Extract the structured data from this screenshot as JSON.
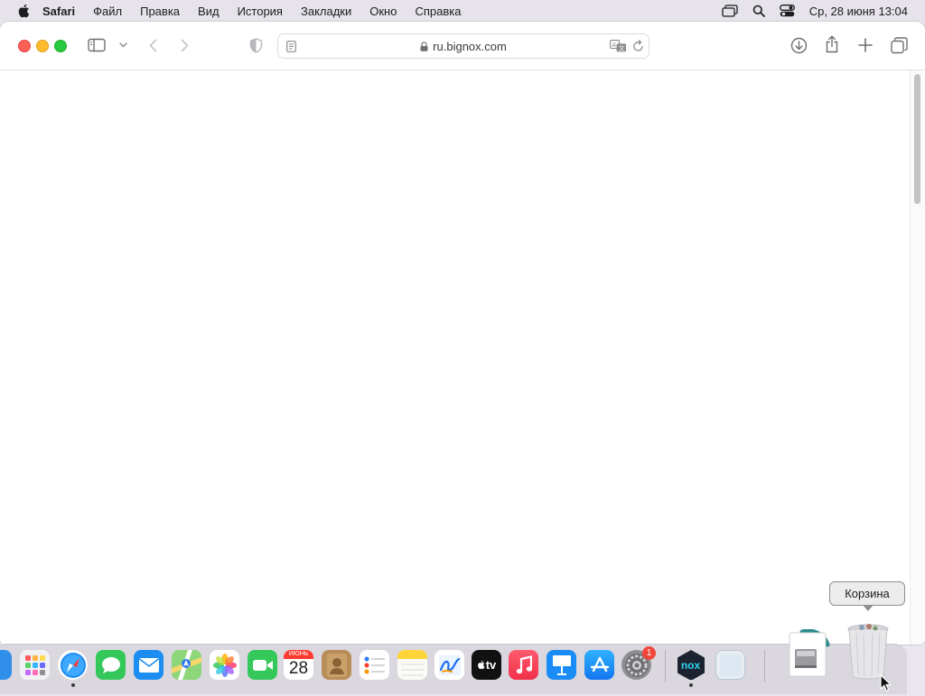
{
  "menubar": {
    "app_name": "Safari",
    "items": [
      "Файл",
      "Правка",
      "Вид",
      "История",
      "Закладки",
      "Окно",
      "Справка"
    ],
    "clock": "Ср, 28 июня  13:04"
  },
  "safari": {
    "url": "ru.bignox.com"
  },
  "tooltip": {
    "text": "Корзина"
  },
  "dock": {
    "calendar_month": "ИЮНЬ",
    "calendar_day": "28",
    "appletv_label": "tv",
    "nox_label": "nox",
    "settings_badge": "1",
    "apps": [
      "finder",
      "launchpad",
      "safari",
      "messages",
      "mail",
      "maps",
      "photos",
      "facetime",
      "calendar",
      "contacts",
      "reminders",
      "notes",
      "freeform",
      "tv",
      "music",
      "keynote",
      "app-store",
      "system-settings",
      "nox",
      "preview",
      "disk-image",
      "trash"
    ]
  },
  "colors": {
    "close": "#fe5f57",
    "minimize": "#febc2e",
    "maximize": "#28c840",
    "accent": "#0a84ff"
  }
}
